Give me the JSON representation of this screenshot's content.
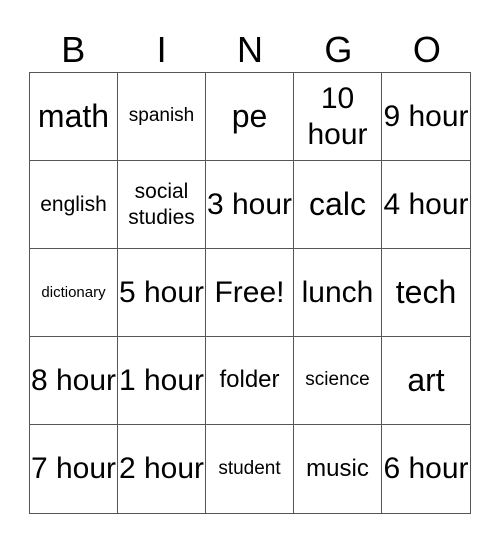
{
  "header": [
    "B",
    "I",
    "N",
    "G",
    "O"
  ],
  "cells": [
    {
      "text": "math",
      "size": "s-xl"
    },
    {
      "text": "spanish",
      "size": "s-s"
    },
    {
      "text": "pe",
      "size": "s-xl"
    },
    {
      "text": "10 hour",
      "size": "s-l"
    },
    {
      "text": "9 hour",
      "size": "s-l"
    },
    {
      "text": "english",
      "size": "s-sm"
    },
    {
      "text": "social studies",
      "size": "s-sm"
    },
    {
      "text": "3 hour",
      "size": "s-l"
    },
    {
      "text": "calc",
      "size": "s-xl"
    },
    {
      "text": "4 hour",
      "size": "s-l"
    },
    {
      "text": "dictionary",
      "size": "s-xs"
    },
    {
      "text": "5 hour",
      "size": "s-l"
    },
    {
      "text": "Free!",
      "size": "s-l"
    },
    {
      "text": "lunch",
      "size": "s-l"
    },
    {
      "text": "tech",
      "size": "s-xl"
    },
    {
      "text": "8 hour",
      "size": "s-l"
    },
    {
      "text": "1 hour",
      "size": "s-l"
    },
    {
      "text": "folder",
      "size": "s-m"
    },
    {
      "text": "science",
      "size": "s-s"
    },
    {
      "text": "art",
      "size": "s-xl"
    },
    {
      "text": "7 hour",
      "size": "s-l"
    },
    {
      "text": "2 hour",
      "size": "s-l"
    },
    {
      "text": "student",
      "size": "s-s"
    },
    {
      "text": "music",
      "size": "s-m"
    },
    {
      "text": "6 hour",
      "size": "s-l"
    }
  ]
}
